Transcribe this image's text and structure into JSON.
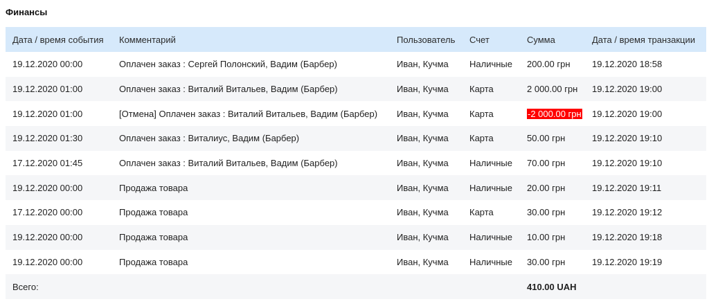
{
  "page": {
    "title": "Финансы"
  },
  "table": {
    "columns": [
      "Дата / время события",
      "Комментарий",
      "Пользователь",
      "Счет",
      "Сумма",
      "Дата / время транзакции"
    ],
    "rows": [
      [
        "19.12.2020 00:00",
        "Оплачен заказ : Сергей Полонский, Вадим (Барбер)",
        "Иван, Кучма",
        "Наличные",
        "200.00 грн",
        "19.12.2020 18:58"
      ],
      [
        "19.12.2020 01:00",
        "Оплачен заказ : Виталий Витальев, Вадим (Барбер)",
        "Иван, Кучма",
        "Карта",
        "2 000.00 грн",
        "19.12.2020 19:00"
      ],
      [
        "19.12.2020 01:00",
        "[Отмена] Оплачен заказ : Виталий Витальев, Вадим (Барбер)",
        "Иван, Кучма",
        "Карта",
        "-2 000.00 грн",
        "19.12.2020 19:00"
      ],
      [
        "19.12.2020 01:30",
        "Оплачен заказ : Виталиус, Вадим (Барбер)",
        "Иван, Кучма",
        "Карта",
        "50.00 грн",
        "19.12.2020 19:10"
      ],
      [
        "17.12.2020 01:45",
        "Оплачен заказ : Виталий Витальев, Вадим (Барбер)",
        "Иван, Кучма",
        "Наличные",
        "70.00 грн",
        "19.12.2020 19:10"
      ],
      [
        "19.12.2020 00:00",
        "Продажа товара",
        "Иван, Кучма",
        "Наличные",
        "20.00 грн",
        "19.12.2020 19:11"
      ],
      [
        "17.12.2020 00:00",
        "Продажа товара",
        "Иван, Кучма",
        "Карта",
        "30.00 грн",
        "19.12.2020 19:12"
      ],
      [
        "19.12.2020 00:00",
        "Продажа товара",
        "Иван, Кучма",
        "Наличные",
        "10.00 грн",
        "19.12.2020 19:18"
      ],
      [
        "19.12.2020 00:00",
        "Продажа товара",
        "Иван, Кучма",
        "Наличные",
        "30.00 грн",
        "19.12.2020 19:19"
      ]
    ],
    "negative_color": "#ff0000",
    "header_bg": "#d6e9fb",
    "total": {
      "label": "Всего:",
      "value": "410.00 UAH"
    }
  }
}
